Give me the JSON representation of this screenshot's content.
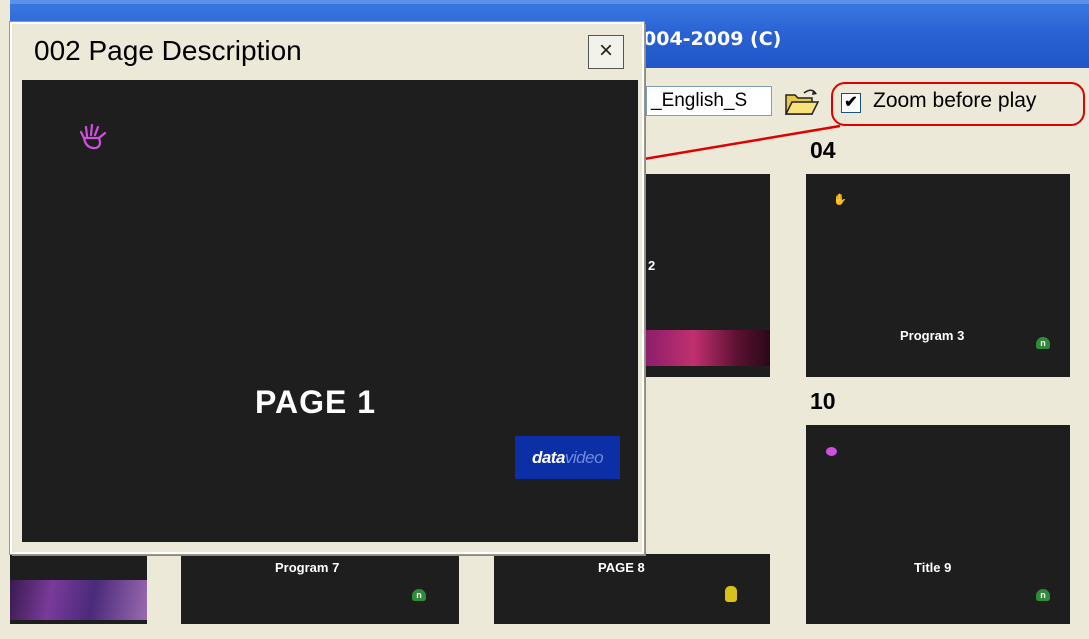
{
  "window": {
    "title_fragment": "004-2009 (C)"
  },
  "toolbar": {
    "file_value": "_English_S",
    "folder_icon": "open-folder-icon",
    "zoom_checkbox_checked": true,
    "zoom_checkbox_mark": "✔",
    "zoom_label": "Zoom before play",
    "highlight_color": "#e00000"
  },
  "grid": {
    "page_numbers": {
      "p04": "04",
      "p10": "10"
    },
    "partial_number": "2",
    "tiles": {
      "program3": {
        "label": "Program 3"
      },
      "program7": {
        "label": "Program 7"
      },
      "page8": {
        "label": "PAGE 8"
      },
      "title9": {
        "label": "Title 9"
      }
    }
  },
  "popup": {
    "title": "002  Page Description",
    "close_glyph": "×",
    "preview_text": "PAGE 1",
    "logo": {
      "part1": "data",
      "part2": "video"
    }
  },
  "icons": {
    "green": "green-status-icon",
    "yellow": "yellow-figure-icon",
    "hand": "hand-icon"
  },
  "colors": {
    "tile_bg": "#1e1e1e",
    "titlebar": "#2a62d3",
    "hand": "#d14fe0"
  }
}
